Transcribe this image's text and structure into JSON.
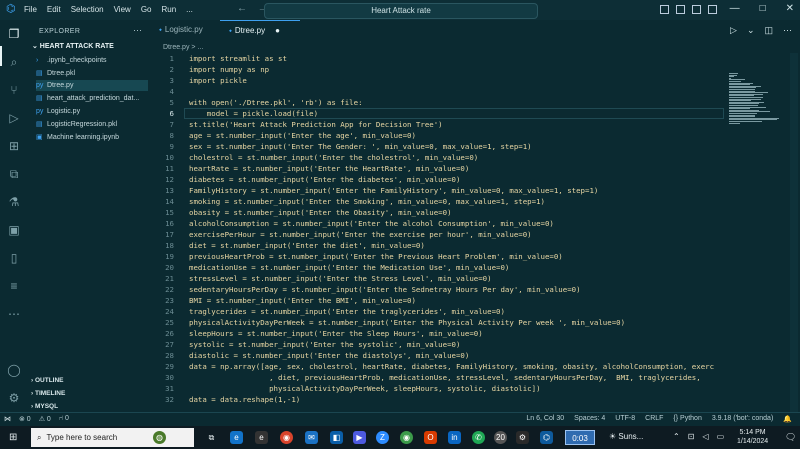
{
  "titlebar": {
    "menu": [
      "File",
      "Edit",
      "Selection",
      "View",
      "Go",
      "Run",
      "..."
    ],
    "search": "Heart Attack rate",
    "nav": "← →",
    "window_controls": [
      "—",
      "□",
      "✕"
    ]
  },
  "sidebar": {
    "header": "EXPLORER",
    "folder": "⌄ HEART ATTACK RATE",
    "files": [
      {
        "icon": "›",
        "label": ".ipynb_checkpoints"
      },
      {
        "icon": "▤",
        "label": "Dtree.pkl"
      },
      {
        "icon": "py",
        "label": "Dtree.py"
      },
      {
        "icon": "▤",
        "label": "heart_attack_prediction_dat..."
      },
      {
        "icon": "py",
        "label": "Logistic.py"
      },
      {
        "icon": "▤",
        "label": "LogisticRegression.pkl"
      },
      {
        "icon": "▣",
        "label": "Machine learning.ipynb"
      }
    ],
    "sections": [
      "› OUTLINE",
      "› TIMELINE",
      "› MYSQL"
    ]
  },
  "tabs": [
    {
      "label": "Logistic.py"
    },
    {
      "label": "Dtree.py",
      "modified": "●"
    }
  ],
  "breadcrumb": "Dtree.py > ...",
  "code": [
    {
      "n": "1",
      "t": "import streamlit as st"
    },
    {
      "n": "2",
      "t": "import numpy as np"
    },
    {
      "n": "3",
      "t": "import pickle"
    },
    {
      "n": "4",
      "t": ""
    },
    {
      "n": "5",
      "t": "with open('./Dtree.pkl', 'rb') as file:"
    },
    {
      "n": "6",
      "t": "    model = pickle.load(file)"
    },
    {
      "n": "7",
      "t": "st.title('Heart Attack Prediction App for Decision Tree')"
    },
    {
      "n": "8",
      "t": "age = st.number_input('Enter the age', min_value=0)"
    },
    {
      "n": "9",
      "t": "sex = st.number_input('Enter The Gender: ', min_value=0, max_value=1, step=1)"
    },
    {
      "n": "10",
      "t": "cholestrol = st.number_input('Enter the cholestrol', min_value=0)"
    },
    {
      "n": "11",
      "t": "heartRate = st.number_input('Enter the HeartRate', min_value=0)"
    },
    {
      "n": "12",
      "t": "diabetes = st.number_input('Enter the diabetes', min_value=0)"
    },
    {
      "n": "13",
      "t": "FamilyHistory = st.number_input('Enter the FamilyHistory', min_value=0, max_value=1, step=1)"
    },
    {
      "n": "14",
      "t": "smoking = st.number_input('Enter the Smoking', min_value=0, max_value=1, step=1)"
    },
    {
      "n": "15",
      "t": "obasity = st.number_input('Enter the Obasity', min_value=0)"
    },
    {
      "n": "16",
      "t": "alcoholConsumption = st.number_input('Enter the alcohol Consumption', min_value=0)"
    },
    {
      "n": "17",
      "t": "exercisePerHour = st.number_input('Enter the exercise per hour', min_value=0)"
    },
    {
      "n": "18",
      "t": "diet = st.number_input('Enter the diet', min_value=0)"
    },
    {
      "n": "19",
      "t": "previousHeartProb = st.number_input('Enter the Previous Heart Problem', min_value=0)"
    },
    {
      "n": "20",
      "t": "medicationUse = st.number_input('Enter the Medication Use', min_value=0)"
    },
    {
      "n": "21",
      "t": "stressLevel = st.number_input('Enter the Stress Level', min_value=0)"
    },
    {
      "n": "22",
      "t": "sedentaryHoursPerDay = st.number_input('Enter the Sednetray Hours Per day', min_value=0)"
    },
    {
      "n": "23",
      "t": "BMI = st.number_input('Enter the BMI', min_value=0)"
    },
    {
      "n": "24",
      "t": "traglycerides = st.number_input('Enter the traglycerides', min_value=0)"
    },
    {
      "n": "25",
      "t": "physicalActivityDayPerWeek = st.number_input('Enter the Physical Activity Per week ', min_value=0)"
    },
    {
      "n": "26",
      "t": "sleepHours = st.number_input('Enter the Sleep Hours', min_value=0)"
    },
    {
      "n": "27",
      "t": "systolic = st.number_input('Enter the systolic', min_value=0)"
    },
    {
      "n": "28",
      "t": "diastolic = st.number_input('Enter the diastolys', min_value=0)"
    },
    {
      "n": "29",
      "t": "data = np.array([age, sex, cholestrol, heartRate, diabetes, FamilyHistory, smoking, obasity, alcoholConsumption, exerc"
    },
    {
      "n": "30",
      "t": "                  , diet, previousHeartProb, medicationUse, stressLevel, sedentaryHoursPerDay,  BMI, traglycerides,"
    },
    {
      "n": "31",
      "t": "                  physicalActivityDayPerWeek, sleepHours, systolic, diastolic])"
    },
    {
      "n": "32",
      "t": "data = data.reshape(1,-1)"
    }
  ],
  "status": {
    "errors": "⊗ 0",
    "warnings": "⚠ 0",
    "ports": "⑁ 0",
    "position": "Ln 6, Col 30",
    "spaces": "Spaces: 4",
    "encoding": "UTF-8",
    "eol": "CRLF",
    "language": "{} Python",
    "interpreter": "3.9.18 ('bot': conda)"
  },
  "taskbar": {
    "search_placeholder": "Type here to search",
    "timer": "0:03",
    "weather": "Suns...",
    "time": "5:14 PM",
    "date": "1/14/2024",
    "badge": "20"
  },
  "colors": {
    "background": "#0b2a31",
    "accent": "#3ea1f0",
    "code_text": "#e8d7a4"
  }
}
